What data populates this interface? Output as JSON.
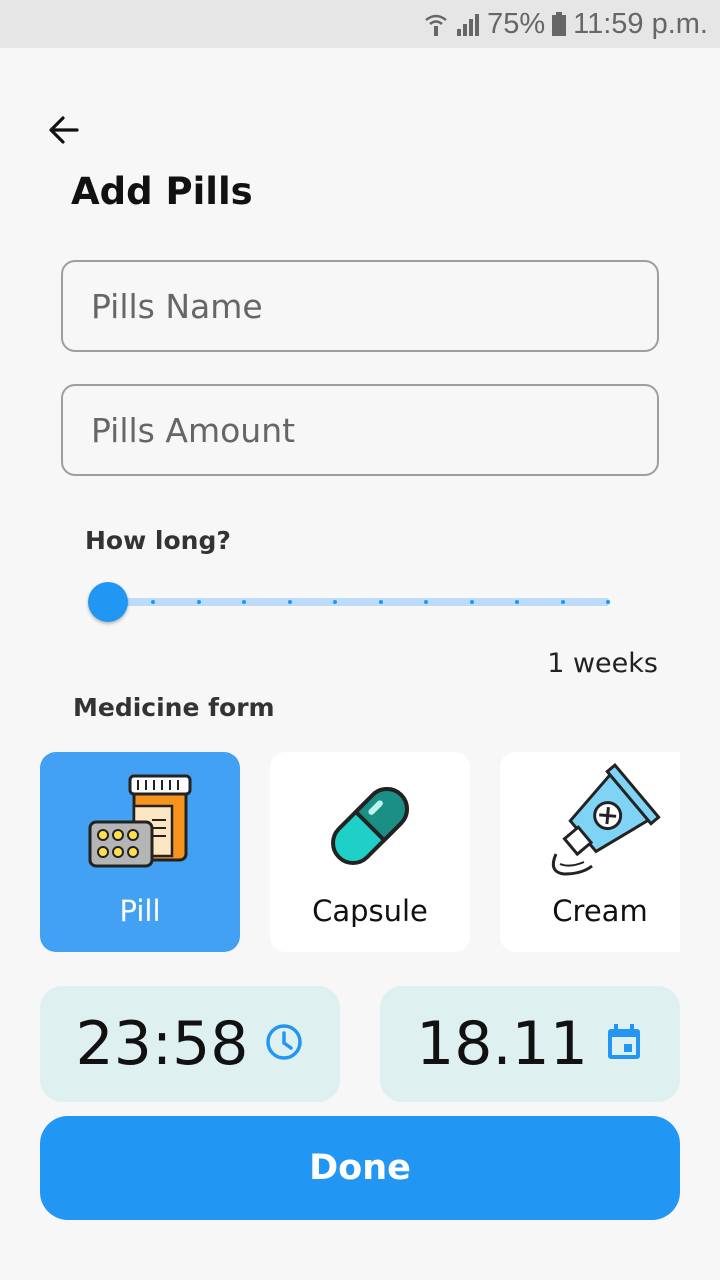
{
  "status_bar": {
    "battery": "75%",
    "time": "11:59 p.m.",
    "icons": [
      "wifi-icon",
      "signal-icon",
      "battery-icon"
    ]
  },
  "header": {
    "title": "Add Pills",
    "back_icon": "arrow-left-icon"
  },
  "inputs": {
    "name_placeholder": "Pills Name",
    "name_value": "",
    "amount_placeholder": "Pills Amount",
    "amount_value": ""
  },
  "duration": {
    "label": "How long?",
    "value_text": "1 weeks",
    "slider": {
      "value": 1,
      "min": 1,
      "max": 12,
      "divisions": 11
    }
  },
  "medicine_form": {
    "label": "Medicine form",
    "options": [
      {
        "label": "Pill",
        "icon": "pill-bottle-icon",
        "selected": true
      },
      {
        "label": "Capsule",
        "icon": "capsule-icon",
        "selected": false
      },
      {
        "label": "Cream",
        "icon": "cream-tube-icon",
        "selected": false
      }
    ]
  },
  "schedule": {
    "time": "23:58",
    "time_icon": "clock-icon",
    "date": "18.11",
    "date_icon": "calendar-icon"
  },
  "done_label": "Done",
  "colors": {
    "accent": "#2196f3",
    "selected_card": "#42a1f3",
    "chip_bg": "#dff0f1",
    "background": "#f7f7f7"
  }
}
